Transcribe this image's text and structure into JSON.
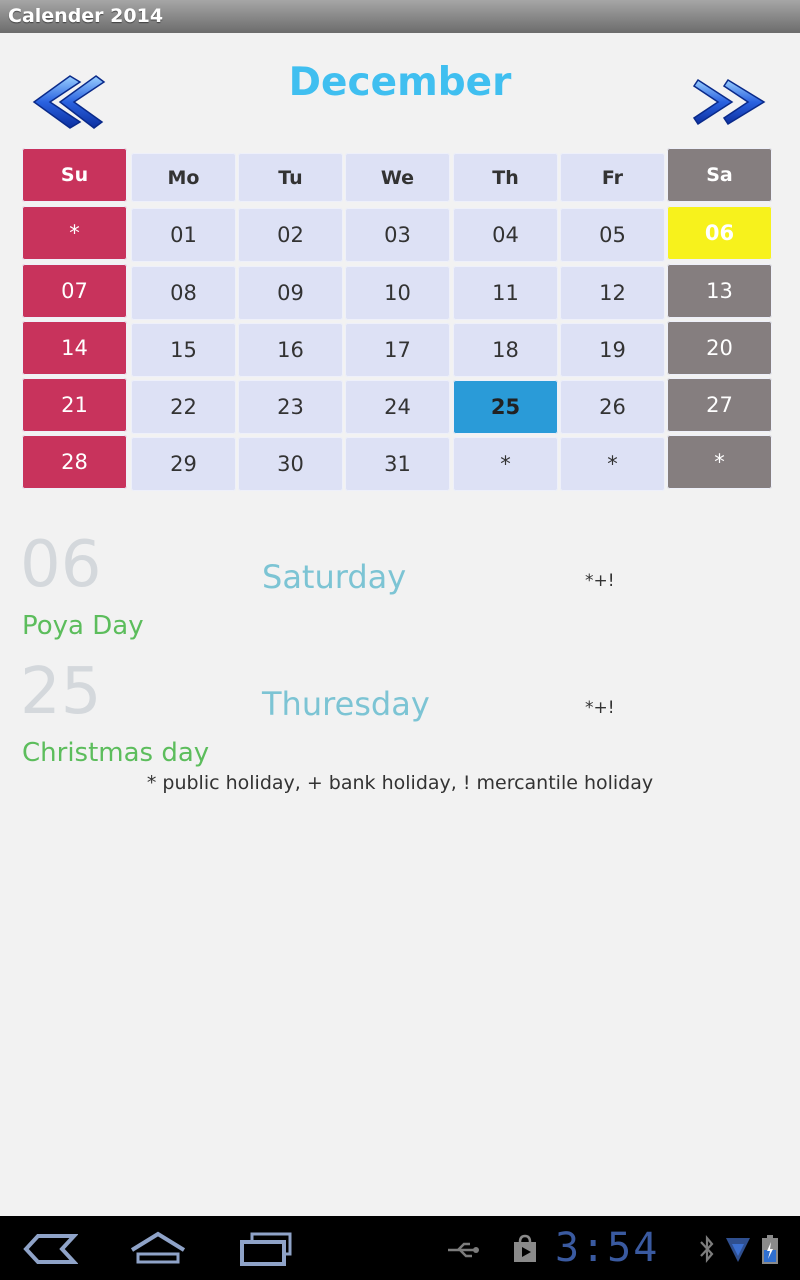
{
  "app": {
    "title": "Calender 2014"
  },
  "calendar": {
    "month": "December",
    "weekdays": [
      "Su",
      "Mo",
      "Tu",
      "We",
      "Th",
      "Fr",
      "Sa"
    ],
    "weeks": [
      [
        "*",
        "01",
        "02",
        "03",
        "04",
        "05",
        "06"
      ],
      [
        "07",
        "08",
        "09",
        "10",
        "11",
        "12",
        "13"
      ],
      [
        "14",
        "15",
        "16",
        "17",
        "18",
        "19",
        "20"
      ],
      [
        "21",
        "22",
        "23",
        "24",
        "25",
        "26",
        "27"
      ],
      [
        "28",
        "29",
        "30",
        "31",
        "*",
        "*",
        "*"
      ]
    ],
    "holiday_day": "06",
    "selected_day": "25",
    "colors": {
      "sunday": "#c8335c",
      "saturday": "#857e7f",
      "weekday": "#dde1f5",
      "holiday_highlight": "#f7f21c",
      "selected_highlight": "#2a9bd8",
      "month_title": "#40bff0"
    }
  },
  "events": [
    {
      "day": "06",
      "weekday": "Saturday",
      "code": "*+!",
      "name": "Poya Day"
    },
    {
      "day": "25",
      "weekday": "Thuresday",
      "code": "*+!",
      "name": "Christmas day"
    }
  ],
  "legend": "* public holiday, + bank holiday, ! mercantile holiday",
  "system_bar": {
    "time": "3:54",
    "icons": [
      "back-icon",
      "home-icon",
      "recent-apps-icon",
      "usb-icon",
      "play-store-icon",
      "bluetooth-icon",
      "wifi-icon",
      "battery-icon"
    ]
  }
}
